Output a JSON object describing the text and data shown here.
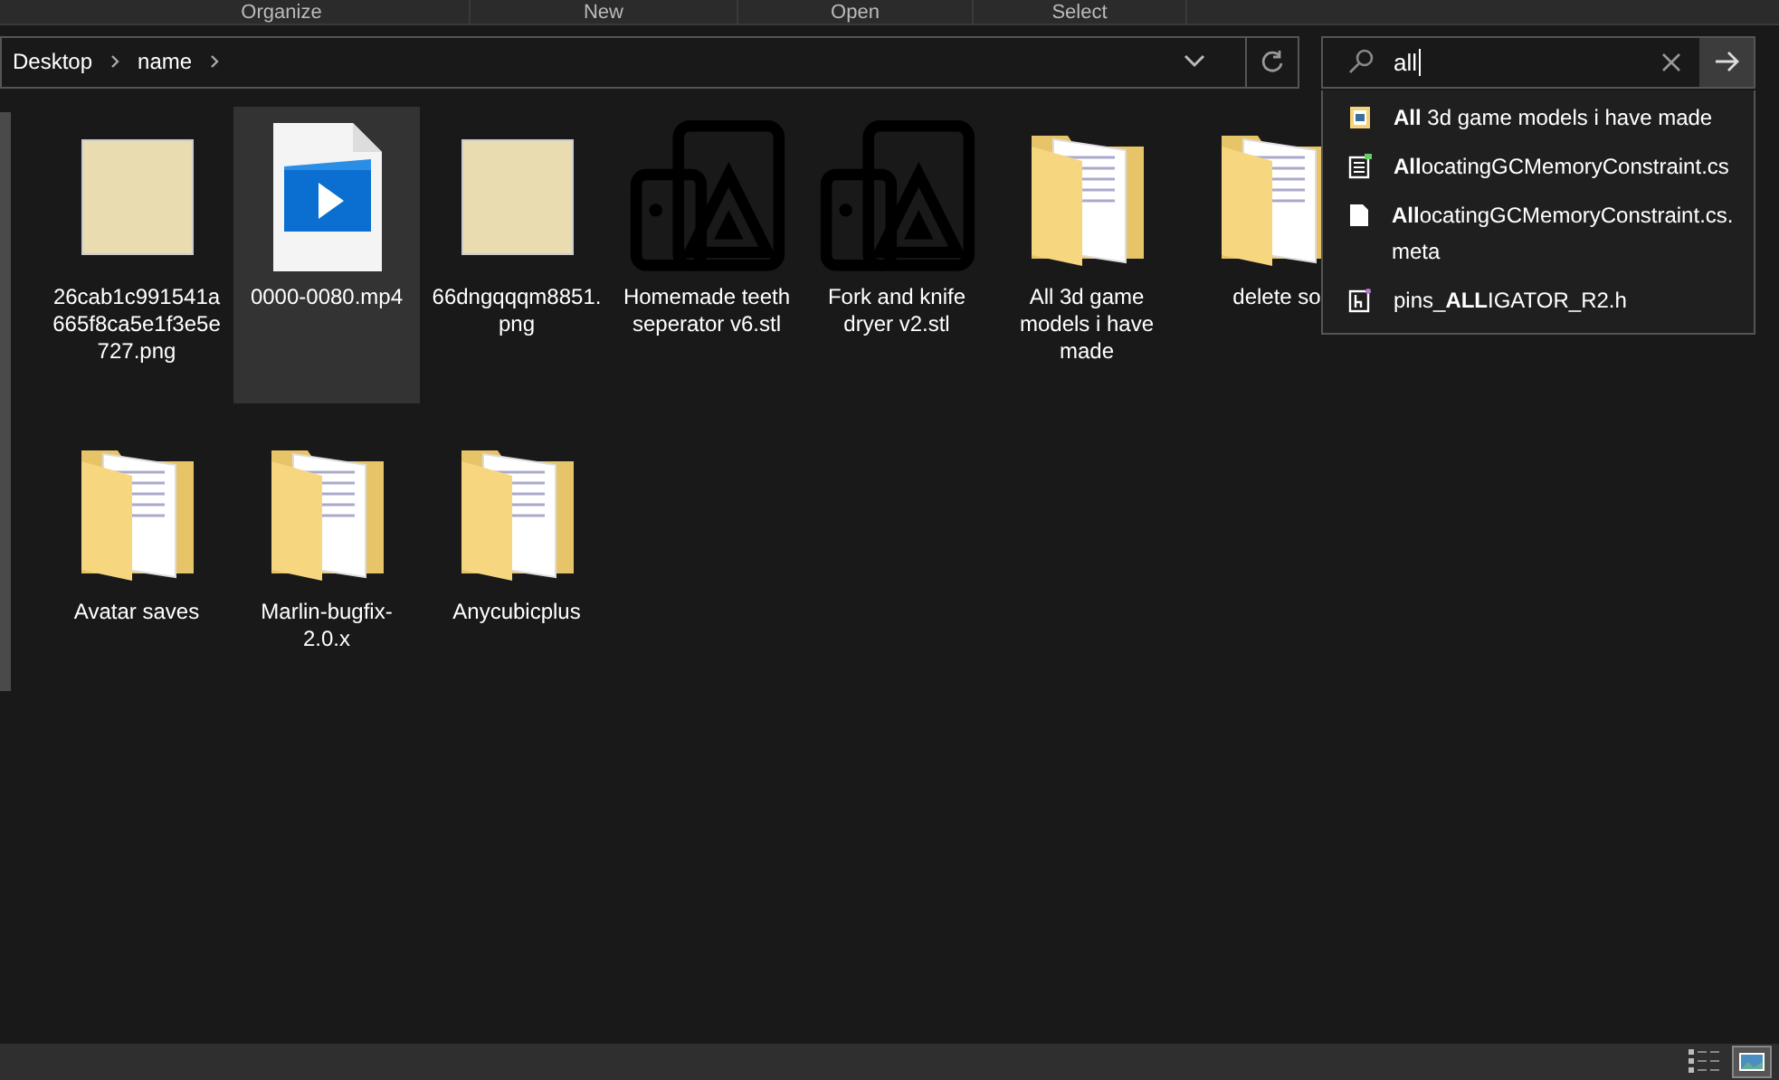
{
  "ribbon": {
    "groups": [
      "Organize",
      "New",
      "Open",
      "Select"
    ]
  },
  "address_bar": {
    "crumbs": [
      "Desktop",
      "name"
    ]
  },
  "search": {
    "value": "all"
  },
  "suggestions": [
    {
      "kind": "folder",
      "text": "**All** 3d game models i have made"
    },
    {
      "kind": "code",
      "text": "**All**ocatingGCMemoryConstraint.cs"
    },
    {
      "kind": "file",
      "text": "**All**ocatingGCMemoryConstraint.cs.meta"
    },
    {
      "kind": "header",
      "text": "pins_**ALL**IGATOR_R2.h"
    }
  ],
  "items": [
    {
      "kind": "image",
      "name": "26cab1c991541a665f8ca5e1f3e5e727.png",
      "selected": false
    },
    {
      "kind": "video",
      "name": "0000-0080.mp4",
      "selected": true
    },
    {
      "kind": "image",
      "name": "66dngqqqm8851.png",
      "selected": false
    },
    {
      "kind": "stl",
      "name": "Homemade teeth seperator v6.stl",
      "selected": false
    },
    {
      "kind": "stl",
      "name": "Fork and knife dryer v2.stl",
      "selected": false
    },
    {
      "kind": "folder",
      "name": "All 3d game models i have made",
      "selected": false
    },
    {
      "kind": "folder",
      "name": "delete so",
      "selected": false
    },
    {
      "kind": "folder",
      "name": "Avatar saves",
      "selected": false
    },
    {
      "kind": "folder",
      "name": "Marlin-bugfix-2.0.x",
      "selected": false
    },
    {
      "kind": "folder",
      "name": "Anycubicplus",
      "selected": false
    }
  ]
}
